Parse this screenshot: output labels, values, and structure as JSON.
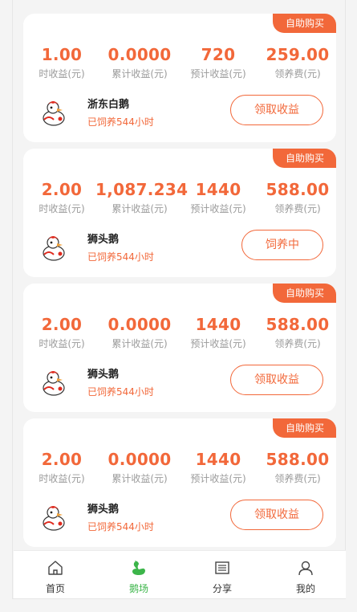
{
  "cards": [
    {
      "badge": "自助购买",
      "stats": [
        {
          "value": "1.00",
          "label": "时收益(元)"
        },
        {
          "value": "0.0000",
          "label": "累计收益(元)"
        },
        {
          "value": "720",
          "label": "预计收益(元)"
        },
        {
          "value": "259.00",
          "label": "领养费(元)"
        }
      ],
      "name": "浙东白鹅",
      "fed": "已饲养544小时",
      "action": "领取收益"
    },
    {
      "badge": "自助购买",
      "stats": [
        {
          "value": "2.00",
          "label": "时收益(元)"
        },
        {
          "value": "1,087.234",
          "label": "累计收益(元)"
        },
        {
          "value": "1440",
          "label": "预计收益(元)"
        },
        {
          "value": "588.00",
          "label": "领养费(元)"
        }
      ],
      "name": "狮头鹅",
      "fed": "已饲养544小时",
      "action": "饲养中"
    },
    {
      "badge": "自助购买",
      "stats": [
        {
          "value": "2.00",
          "label": "时收益(元)"
        },
        {
          "value": "0.0000",
          "label": "累计收益(元)"
        },
        {
          "value": "1440",
          "label": "预计收益(元)"
        },
        {
          "value": "588.00",
          "label": "领养费(元)"
        }
      ],
      "name": "狮头鹅",
      "fed": "已饲养544小时",
      "action": "领取收益"
    },
    {
      "badge": "自助购买",
      "stats": [
        {
          "value": "2.00",
          "label": "时收益(元)"
        },
        {
          "value": "0.0000",
          "label": "累计收益(元)"
        },
        {
          "value": "1440",
          "label": "预计收益(元)"
        },
        {
          "value": "588.00",
          "label": "领养费(元)"
        }
      ],
      "name": "狮头鹅",
      "fed": "已饲养544小时",
      "action": "领取收益"
    }
  ],
  "nav": [
    {
      "label": "首页",
      "icon": "home-icon"
    },
    {
      "label": "鹅场",
      "icon": "goose-farm-icon",
      "active": true
    },
    {
      "label": "分享",
      "icon": "share-icon"
    },
    {
      "label": "我的",
      "icon": "user-icon"
    }
  ],
  "colors": {
    "accent": "#f2683a",
    "active_nav": "#3cb54a"
  }
}
